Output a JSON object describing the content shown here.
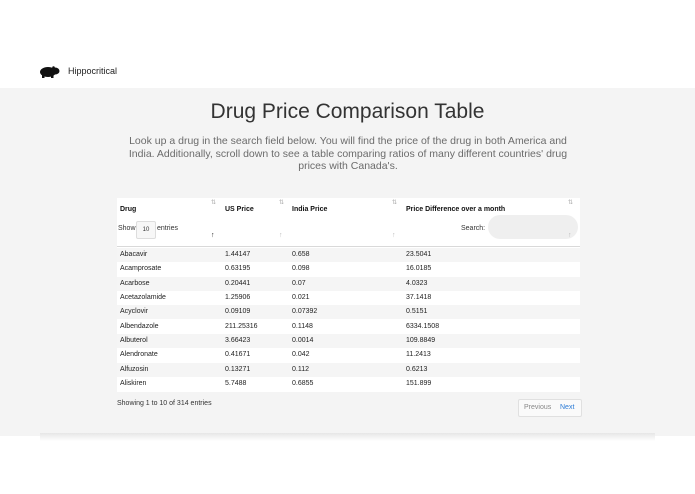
{
  "brand": {
    "name": "Hippocritical",
    "logo_icon": "hippo-icon"
  },
  "page": {
    "title": "Drug Price Comparison Table",
    "description": "Look up a drug in the search field below. You will find the price of the drug in both America and India. Additionally, scroll down to see a table comparing ratios of many different countries' drug prices with Canada's."
  },
  "table": {
    "columns": [
      "Drug",
      "US Price",
      "India Price",
      "Price Difference over a month"
    ],
    "length_label_pre": "Show",
    "length_value": "10",
    "length_label_post": "entries",
    "search_label": "Search:",
    "search_value": "",
    "rows": [
      [
        "Abacavir",
        "1.44147",
        "0.658",
        "23.5041"
      ],
      [
        "Acamprosate",
        "0.63195",
        "0.098",
        "16.0185"
      ],
      [
        "Acarbose",
        "0.20441",
        "0.07",
        "4.0323"
      ],
      [
        "Acetazolamide",
        "1.25906",
        "0.021",
        "37.1418"
      ],
      [
        "Acyclovir",
        "0.09109",
        "0.07392",
        "0.5151"
      ],
      [
        "Albendazole",
        "211.25316",
        "0.1148",
        "6334.1508"
      ],
      [
        "Albuterol",
        "3.66423",
        "0.0014",
        "109.8849"
      ],
      [
        "Alendronate",
        "0.41671",
        "0.042",
        "11.2413"
      ],
      [
        "Alfuzosin",
        "0.13271",
        "0.112",
        "0.6213"
      ],
      [
        "Aliskiren",
        "5.7488",
        "0.6855",
        "151.899"
      ]
    ],
    "info": "Showing 1 to 10 of 314 entries",
    "prev_label": "Previous",
    "next_label": "Next"
  },
  "colors": {
    "background": "#f4f4f4",
    "link": "#2b7bd6"
  }
}
